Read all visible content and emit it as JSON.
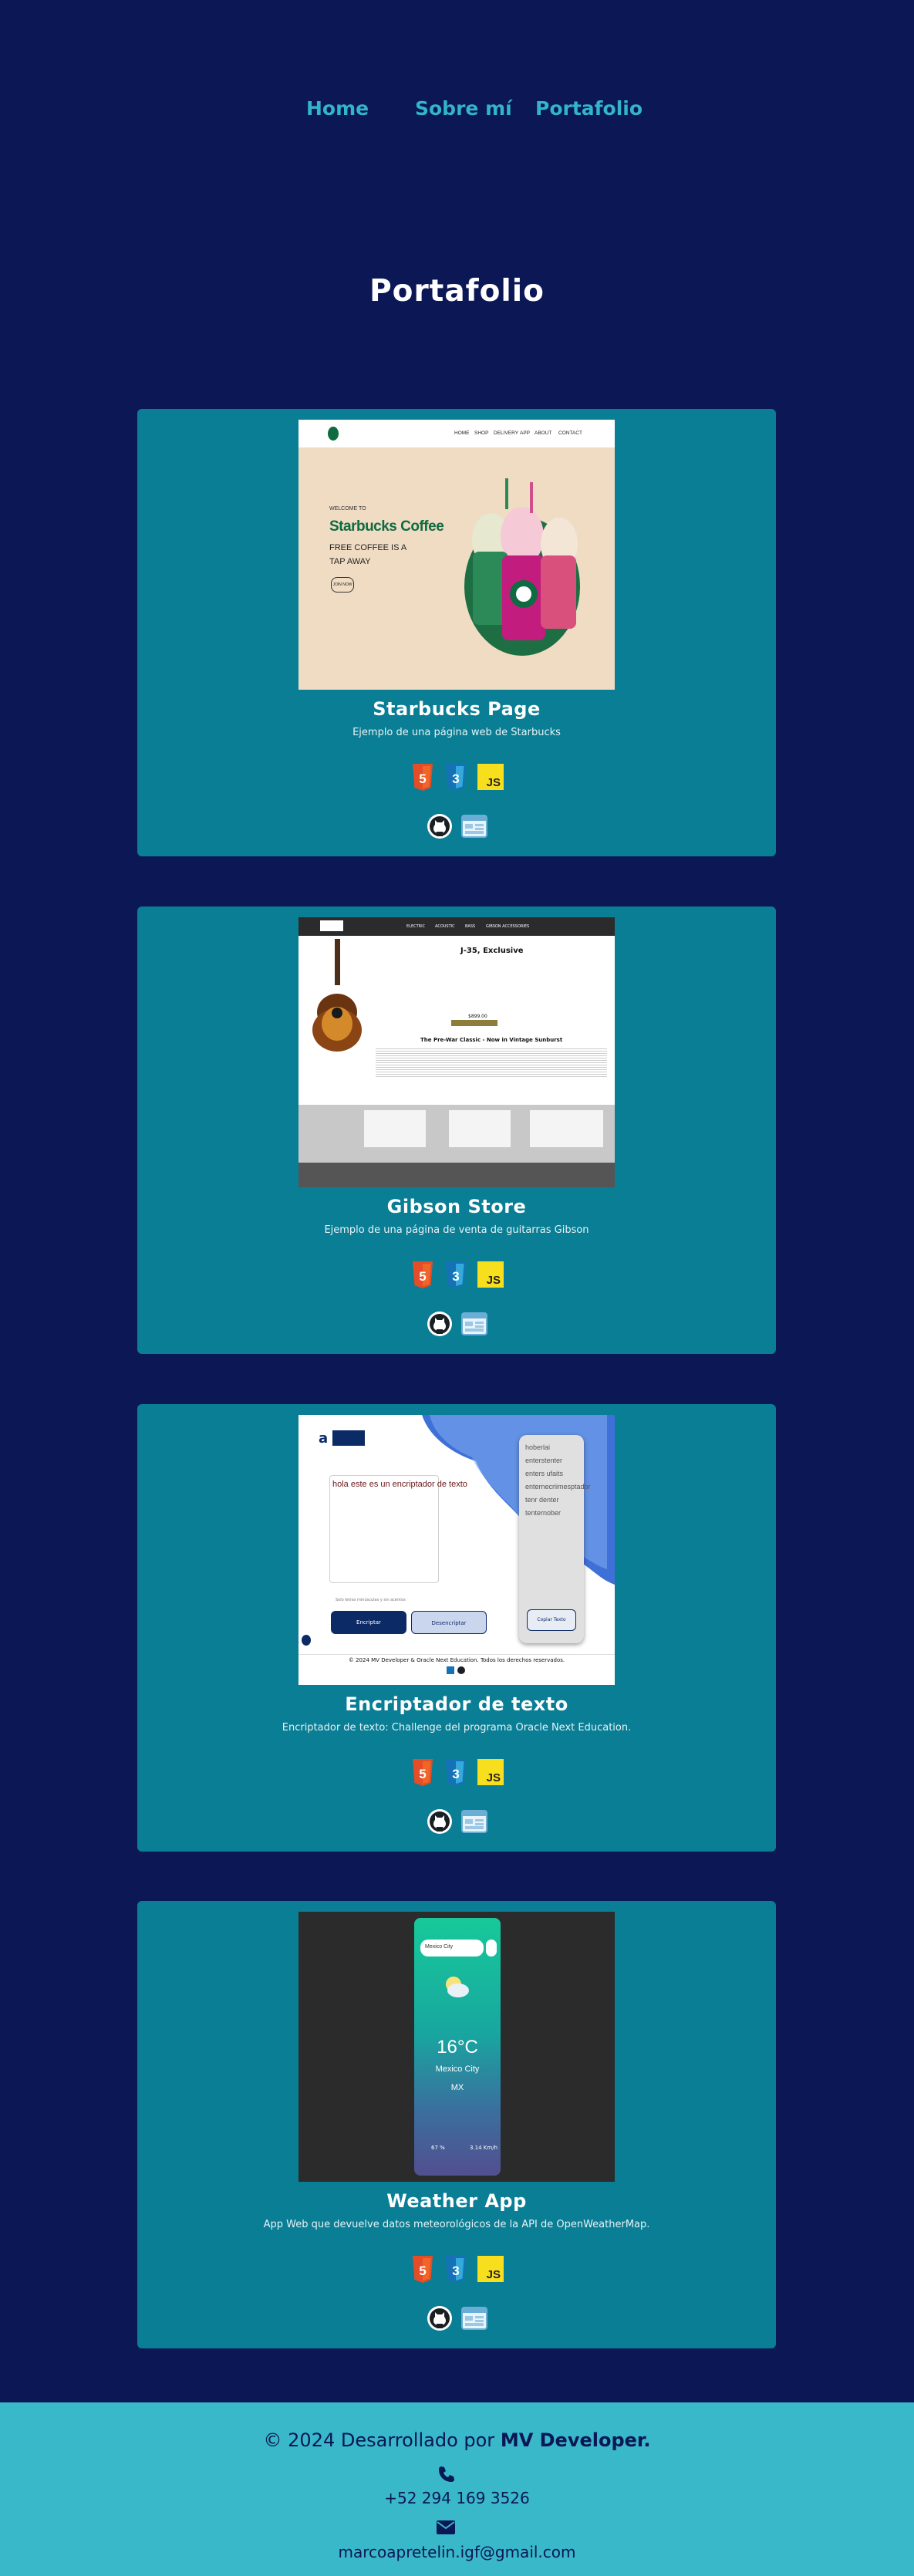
{
  "nav": {
    "home": "Home",
    "about": "Sobre mí",
    "portfolio": "Portafolio"
  },
  "page_title": "Portafolio",
  "projects": [
    {
      "title": "Starbucks Page",
      "description": "Ejemplo de una página web de Starbucks",
      "shot": {
        "nav": [
          "HOME",
          "SHOP",
          "DELIVERY",
          "APP",
          "ABOUT",
          "CONTACT"
        ],
        "welcome": "WELCOME TO",
        "brand": "Starbucks Coffee",
        "tagline1": "FREE COFFEE IS A",
        "tagline2": "TAP AWAY",
        "button": "JOIN NOW"
      }
    },
    {
      "title": "Gibson Store",
      "description": "Ejemplo de una página de venta de guitarras Gibson",
      "shot": {
        "nav": [
          "ELECTRIC",
          "ACOUSTIC",
          "BASS",
          "GIBSON ACCESSORIES"
        ],
        "product": "J-35, Exclusive",
        "price": "$899.00",
        "subtitle": "The Pre-War Classic - Now in Vintage Sunburst"
      }
    },
    {
      "title": "Encriptador de texto",
      "description": "Encriptador de texto: Challenge del programa Oracle Next Education.",
      "shot": {
        "input": "hola este es un encriptador de texto",
        "output": "hoberlai enterstenter enters ufaits enternecriimesptador tenr denter tenternober",
        "encrypt": "Encriptar",
        "decrypt": "Desencriptar",
        "copy": "Copiar Texto",
        "footer": "© 2024 MV Developer & Oracle Next Education. Todos los derechos reservados.",
        "hint": "Solo letras minúsculas y sin acentos"
      }
    },
    {
      "title": "Weather App",
      "description": "App Web que devuelve datos meteorológicos de la API de OpenWeatherMap.",
      "shot": {
        "search": "Mexico City",
        "temp": "16°C",
        "city": "Mexico City",
        "country": "MX",
        "humidity": "67 %",
        "wind": "3.14 Km/h"
      }
    }
  ],
  "tech_icons": [
    "html5-icon",
    "css3-icon",
    "javascript-icon"
  ],
  "link_icons": [
    "github-icon",
    "browser-icon"
  ],
  "colors": {
    "background": "#0c1755",
    "card": "#097e95",
    "accent": "#32b5c9",
    "footer": "#38b8c8"
  },
  "footer": {
    "copyright": "© 2024 Desarrollado por",
    "author": "MV Developer.",
    "phone": "+52 294 169 3526",
    "email": "marcoapretelin.igf@gmail.com"
  }
}
